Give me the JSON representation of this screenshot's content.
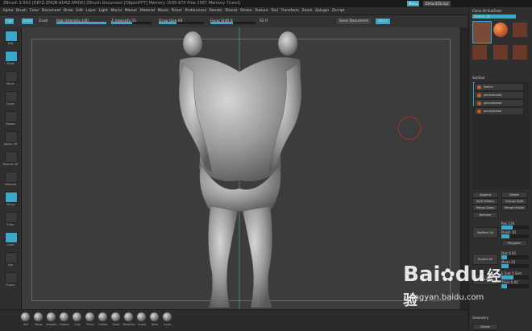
{
  "title_bar": {
    "text": "ZBrush 3.5R3 [DKYZ-ZNQB-ADRZ-XMDK]   ZBrush Document   [ObjectFPT] Memory 1595-670 Free 2587 Memory 7(uncl)"
  },
  "menu": [
    "Alpha",
    "Brush",
    "Color",
    "Document",
    "Draw",
    "Edit",
    "Layer",
    "Light",
    "Macro",
    "Marker",
    "Material",
    "Movie",
    "Picker",
    "Preferences",
    "Render",
    "Stencil",
    "Stroke",
    "Texture",
    "Tool",
    "Transform",
    "Zoom",
    "Zplugin",
    "Zscript"
  ],
  "menu_right": {
    "hide_button": "Menu",
    "script": "DefaultZScript"
  },
  "toolbar": {
    "rgb": "Rgb",
    "zadd": "Zadd",
    "zsub": "Zsub",
    "rgb_intensity": "Rgb Intensity 100",
    "z_intensity": "Z Intensity 51",
    "draw_size": "Draw Size 64",
    "focal_shift": "Focal Shift 0",
    "angle": "S2 0",
    "save_doc": "Save Document",
    "quicksave": "Store"
  },
  "sliders": {
    "rgb_intensity": 1.0,
    "z_intensity": 0.51,
    "draw_size": 0.4,
    "focal_shift": 0.5
  },
  "left_shelf": [
    {
      "label": "Edit",
      "active": true
    },
    {
      "label": "Draw",
      "active": true
    },
    {
      "label": "Move",
      "active": false
    },
    {
      "label": "Scale",
      "active": false
    },
    {
      "label": "Rotate",
      "active": false
    },
    {
      "label": "Alpha Off",
      "active": false
    },
    {
      "label": "Texture Off",
      "active": false
    },
    {
      "label": "Material",
      "active": false
    },
    {
      "label": "Persp",
      "active": true
    },
    {
      "label": "Floor",
      "active": false
    },
    {
      "label": "Local",
      "active": true
    },
    {
      "label": "Xyz",
      "active": false
    },
    {
      "label": "Frame",
      "active": false
    }
  ],
  "bottom_brushes": [
    "Std",
    "Move",
    "Smooth",
    "Flatten",
    "Clay",
    "Pinch",
    "Inflate",
    "Zadd",
    "MaskPen",
    "Snake",
    "Blob",
    "Layer"
  ],
  "right_panel": {
    "header": "Clone  All SubTools",
    "tool_name": "Sketch_50",
    "tool_slots": [
      "Sketch",
      "SphereGrp",
      "Zsphere PolyMesh",
      "genesis3",
      "genesis3 PM3D",
      "genesis3 genesis3"
    ],
    "subtool_title": "SubTool",
    "subtools": [
      "Sketch",
      "genesishead",
      "genesishead",
      "genesishead"
    ],
    "append": "Append",
    "delete": "Delete",
    "split_hidden": "Split Hidden",
    "groups_split": "Groups Split",
    "merge_down": "Merge Down",
    "merge_visible": "Merge Visible",
    "rename": "Rename",
    "remesh_all": "ReMesh All",
    "res": "Res 128",
    "polish": "Polish 10",
    "polygons": "Polygons",
    "project_all": "Project All",
    "dist": "Dist 0.02",
    "mean": "Mean 25",
    "extract": "Extract",
    "e_smt": "E Smt 5 Smt",
    "thick": "Thick 0.02",
    "geometry": "Geometry",
    "divide": "Divide"
  },
  "watermark": {
    "brand": "Bai",
    "du": "du",
    "chinese": "经验",
    "url": "jingyan.baidu.com"
  },
  "colors": {
    "accent": "#3ba7c9",
    "canvas": "#3c3c3c",
    "brush_ring": "#c0302a"
  }
}
